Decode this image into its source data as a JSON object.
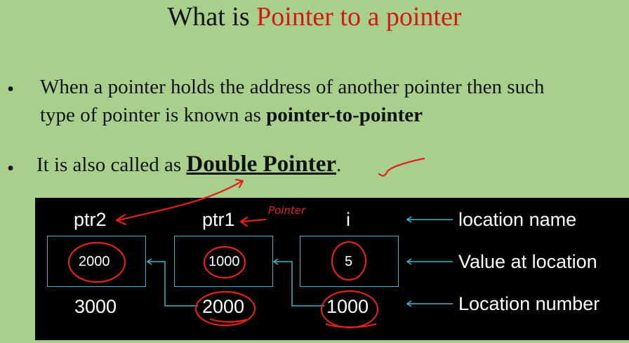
{
  "slide": {
    "title_plain": "What is ",
    "title_accent": "Pointer to a pointer",
    "bullet1_line1": "When a pointer holds the address of another pointer then such",
    "bullet1_line2_prefix": "type of pointer is known as ",
    "bullet1_line2_bold": "pointer-to-pointer",
    "bullet2_prefix": "It is also called as ",
    "bullet2_bold": "Double Pointer",
    "bullet2_suffix": ".",
    "bullet_glyph": "•"
  },
  "diagram": {
    "cells": [
      {
        "name": "ptr2",
        "value": "2000",
        "address": "3000"
      },
      {
        "name": "ptr1",
        "value": "1000",
        "address": "2000"
      },
      {
        "name": "i",
        "value": "5",
        "address": "1000"
      }
    ],
    "legend": {
      "location_name": "location name",
      "value_at_location": "Value at location",
      "location_number": "Location number"
    },
    "annotation": "Pointer"
  },
  "colors": {
    "background": "#a9cf8c",
    "accent": "#d21a12",
    "box_border": "#3fb6c7",
    "ink": "#e0231a"
  }
}
